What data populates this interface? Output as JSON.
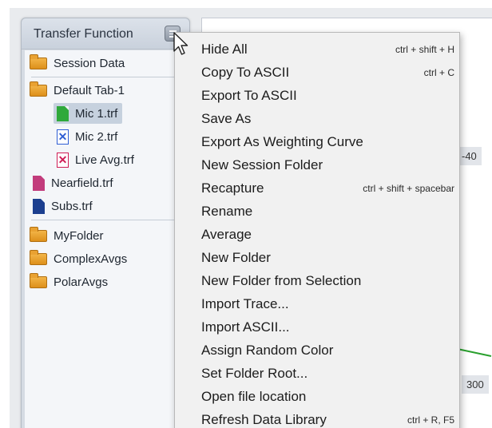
{
  "panel": {
    "title": "Transfer Function"
  },
  "library": {
    "session_data": "Session Data",
    "default_tab": "Default Tab-1",
    "mic1": "Mic 1.trf",
    "mic2": "Mic 2.trf",
    "live_avg": "Live Avg.trf",
    "nearfield": "Nearfield.trf",
    "subs": "Subs.trf",
    "my_folder": "MyFolder",
    "complex_avgs": "ComplexAvgs",
    "polar_avgs": "PolarAvgs"
  },
  "plot": {
    "label_a": "-40",
    "label_b": "300"
  },
  "menu": {
    "items": [
      {
        "label": "Hide All",
        "shortcut": "ctrl + shift + H"
      },
      {
        "label": "Copy To ASCII",
        "shortcut": "ctrl + C"
      },
      {
        "label": "Export To ASCII",
        "shortcut": ""
      },
      {
        "label": "Save As",
        "shortcut": ""
      },
      {
        "label": "Export As Weighting Curve",
        "shortcut": ""
      },
      {
        "label": "New Session Folder",
        "shortcut": ""
      },
      {
        "label": "Recapture",
        "shortcut": "ctrl + shift + spacebar"
      },
      {
        "label": "Rename",
        "shortcut": ""
      },
      {
        "label": "Average",
        "shortcut": ""
      },
      {
        "label": "New Folder",
        "shortcut": ""
      },
      {
        "label": "New Folder from Selection",
        "shortcut": ""
      },
      {
        "label": "Import Trace...",
        "shortcut": ""
      },
      {
        "label": "Import ASCII...",
        "shortcut": ""
      },
      {
        "label": "Assign Random Color",
        "shortcut": ""
      },
      {
        "label": "Set Folder Root...",
        "shortcut": ""
      },
      {
        "label": "Open file location",
        "shortcut": ""
      },
      {
        "label": "Refresh Data Library",
        "shortcut": "ctrl + R, F5"
      }
    ]
  },
  "colors": {
    "folder": "#e9a232",
    "trace_green": "#2fa93b",
    "trace_blue": "#2f5ed4",
    "trace_red": "#cf1d55",
    "trace_magenta": "#c23c7c",
    "trace_navy": "#1c3f8f"
  },
  "icons": {
    "menu_button": "hamburger-menu-icon",
    "folder": "folder-icon",
    "trace_file": "document-icon",
    "hidden_trace": "x-box-icon",
    "cursor": "arrow-cursor-icon"
  }
}
